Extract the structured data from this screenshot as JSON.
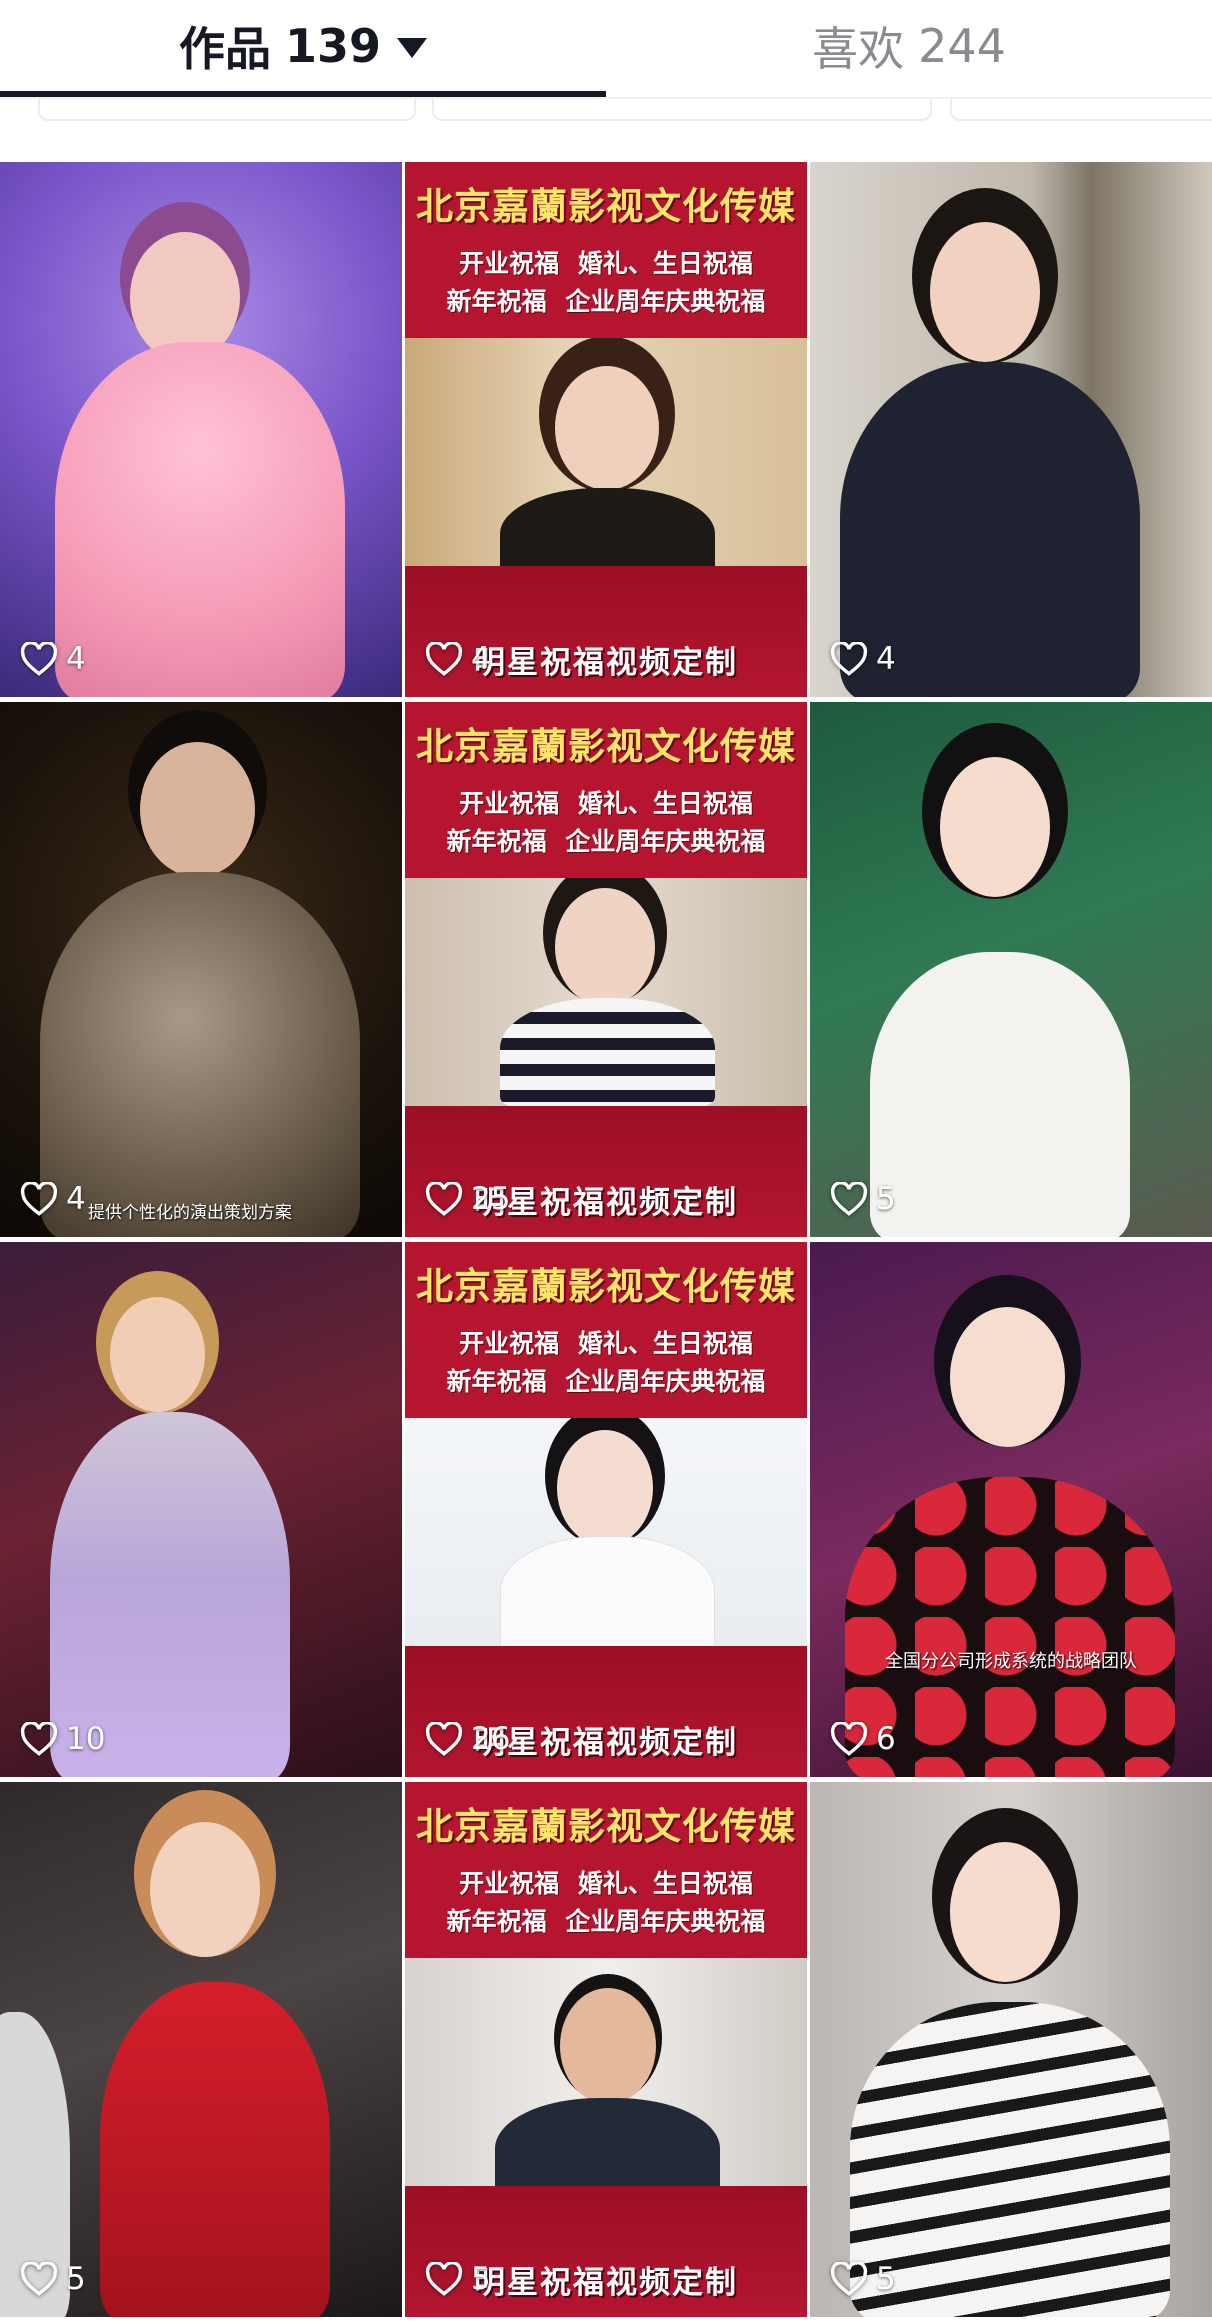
{
  "tabs": [
    {
      "label": "作品",
      "count": "139",
      "selected": true
    },
    {
      "label": "喜欢",
      "count": "244",
      "selected": false
    }
  ],
  "colors": {
    "text_primary": "#161823",
    "text_secondary": "#8a8b91",
    "promo_red": "#b5152f",
    "promo_yellow": "#ffe66a"
  },
  "promo_card": {
    "title": "北京嘉蘭影视文化传媒",
    "line1": "开业祝福  婚礼、生日祝福",
    "line2": "新年祝福  企业周年庆典祝福",
    "caption": "明星祝福视频定制"
  },
  "videos": [
    {
      "likes": "4",
      "icon": "heart-outline-icon"
    },
    {
      "likes": "4",
      "icon": "heart-outline-icon",
      "promo": true
    },
    {
      "likes": "4",
      "icon": "heart-outline-icon"
    },
    {
      "likes": "4",
      "icon": "heart-outline-icon",
      "subtitle": "提供个性化的演出策划方案"
    },
    {
      "likes": "25",
      "icon": "heart-outline-icon",
      "promo": true
    },
    {
      "likes": "5",
      "icon": "heart-outline-icon"
    },
    {
      "likes": "10",
      "icon": "heart-outline-icon"
    },
    {
      "likes": "26",
      "icon": "heart-outline-icon",
      "promo": true
    },
    {
      "likes": "6",
      "icon": "heart-outline-icon",
      "subtitle": "全国分公司形成系统的战略团队"
    },
    {
      "likes": "5",
      "icon": "heart-outline-icon"
    },
    {
      "likes": "5",
      "icon": "heart-outline-icon",
      "promo": true
    },
    {
      "likes": "5",
      "icon": "heart-outline-icon"
    }
  ]
}
